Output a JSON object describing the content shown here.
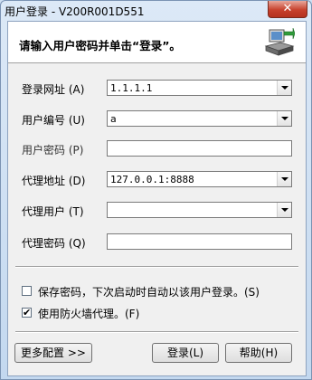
{
  "window": {
    "title": "用户登录 - V200R001D551",
    "close_symbol": "✕"
  },
  "header": {
    "prompt": "请输入用户密码并单击“登录”。"
  },
  "form": {
    "login_url": {
      "label": "登录网址",
      "accel": "(A)",
      "value": "1.1.1.1"
    },
    "user_id": {
      "label": "用户编号",
      "accel": "(U)",
      "value": "a"
    },
    "password": {
      "label": "用户密码",
      "accel": "(P)",
      "value": ""
    },
    "proxy_address": {
      "label": "代理地址",
      "accel": "(D)",
      "value": "127.0.0.1:8888"
    },
    "proxy_user": {
      "label": "代理用户",
      "accel": "(T)",
      "value": ""
    },
    "proxy_password": {
      "label": "代理密码",
      "accel": "(Q)",
      "value": ""
    }
  },
  "options": {
    "save_password": {
      "label": "保存密码，下次启动时自动以该用户登录。(S)",
      "checked": false
    },
    "use_firewall_proxy": {
      "label": "使用防火墙代理。(F)",
      "checked": true,
      "mark": "✔"
    }
  },
  "buttons": {
    "more": "更多配置 >>",
    "login": "登录(L)",
    "help": "帮助(H)"
  },
  "icons": {
    "header": "computer-network-icon"
  }
}
